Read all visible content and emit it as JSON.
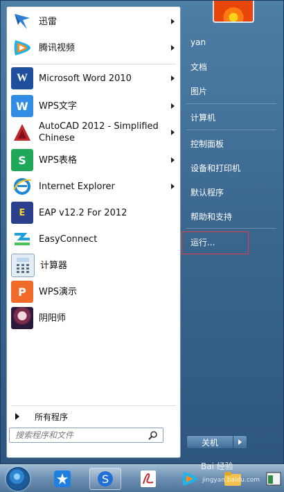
{
  "programs": [
    {
      "label": "迅雷",
      "has_submenu": true,
      "icon": "xunlei-icon"
    },
    {
      "label": "腾讯视频",
      "has_submenu": true,
      "icon": "tencent-video-icon"
    },
    {
      "label": "Microsoft Word 2010",
      "has_submenu": true,
      "icon": "word-icon"
    },
    {
      "label": "WPS文字",
      "has_submenu": true,
      "icon": "wps-writer-icon"
    },
    {
      "label": "AutoCAD 2012 - Simplified Chinese",
      "has_submenu": true,
      "icon": "autocad-icon"
    },
    {
      "label": "WPS表格",
      "has_submenu": true,
      "icon": "wps-spreadsheet-icon"
    },
    {
      "label": "Internet Explorer",
      "has_submenu": true,
      "icon": "ie-icon"
    },
    {
      "label": "EAP v12.2 For 2012",
      "has_submenu": false,
      "icon": "eap-icon"
    },
    {
      "label": "EasyConnect",
      "has_submenu": false,
      "icon": "easyconnect-icon"
    },
    {
      "label": "计算器",
      "has_submenu": false,
      "icon": "calculator-icon"
    },
    {
      "label": "WPS演示",
      "has_submenu": false,
      "icon": "wps-presentation-icon"
    },
    {
      "label": "阴阳师",
      "has_submenu": false,
      "icon": "onmyoji-icon"
    }
  ],
  "all_programs": "所有程序",
  "search": {
    "placeholder": "搜索程序和文件"
  },
  "right_items": [
    "yan",
    "文档",
    "图片",
    "计算机",
    "控制面板",
    "设备和打印机",
    "默认程序",
    "帮助和支持",
    "运行..."
  ],
  "shutdown_label": "关机",
  "watermark": {
    "logo": "Bai 经验",
    "url": "jingyan.baidu.com"
  },
  "colors": {
    "highlight_box": "#e14040"
  }
}
